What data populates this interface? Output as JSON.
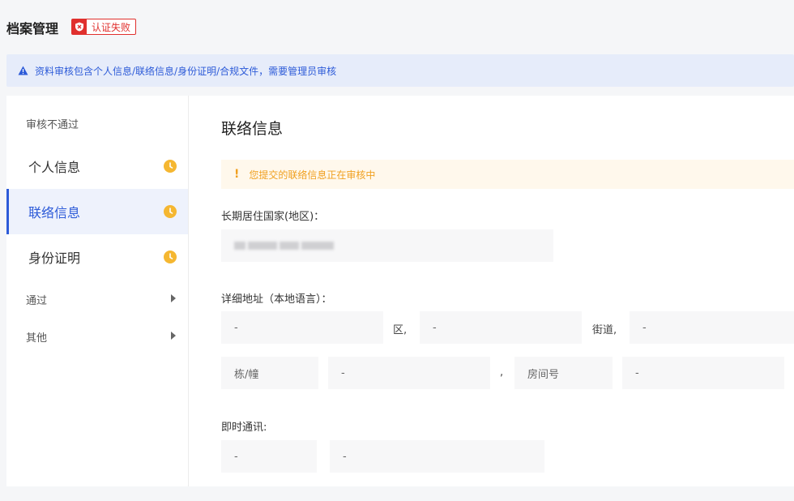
{
  "header": {
    "title": "档案管理",
    "badge": "认证失败"
  },
  "notice": {
    "text": "资料审核包含个人信息/联络信息/身份证明/合规文件，需要管理员审核"
  },
  "sidebar": {
    "group_failed": "审核不通过",
    "items": [
      {
        "label": "个人信息",
        "active": false
      },
      {
        "label": "联络信息",
        "active": true
      },
      {
        "label": "身份证明",
        "active": false
      }
    ],
    "group_passed": "通过",
    "group_other": "其他"
  },
  "content": {
    "title": "联络信息",
    "warning": "您提交的联络信息正在审核中",
    "country_label": "长期居住国家(地区)：",
    "address_label": "详细地址（本地语言）：",
    "district_value": "-",
    "district_sep": "区,",
    "street_value": "-",
    "street_sep": "街道,",
    "road_value": "-",
    "building_label": "栋/幢",
    "building_value": "-",
    "building_sep": ",",
    "room_label": "房间号",
    "room_value": "-",
    "im_label": "即时通讯:",
    "im_type_value": "-",
    "im_account_value": "-"
  },
  "colors": {
    "accent": "#2d5bd8",
    "danger": "#e0302e",
    "warning": "#f0a020"
  }
}
